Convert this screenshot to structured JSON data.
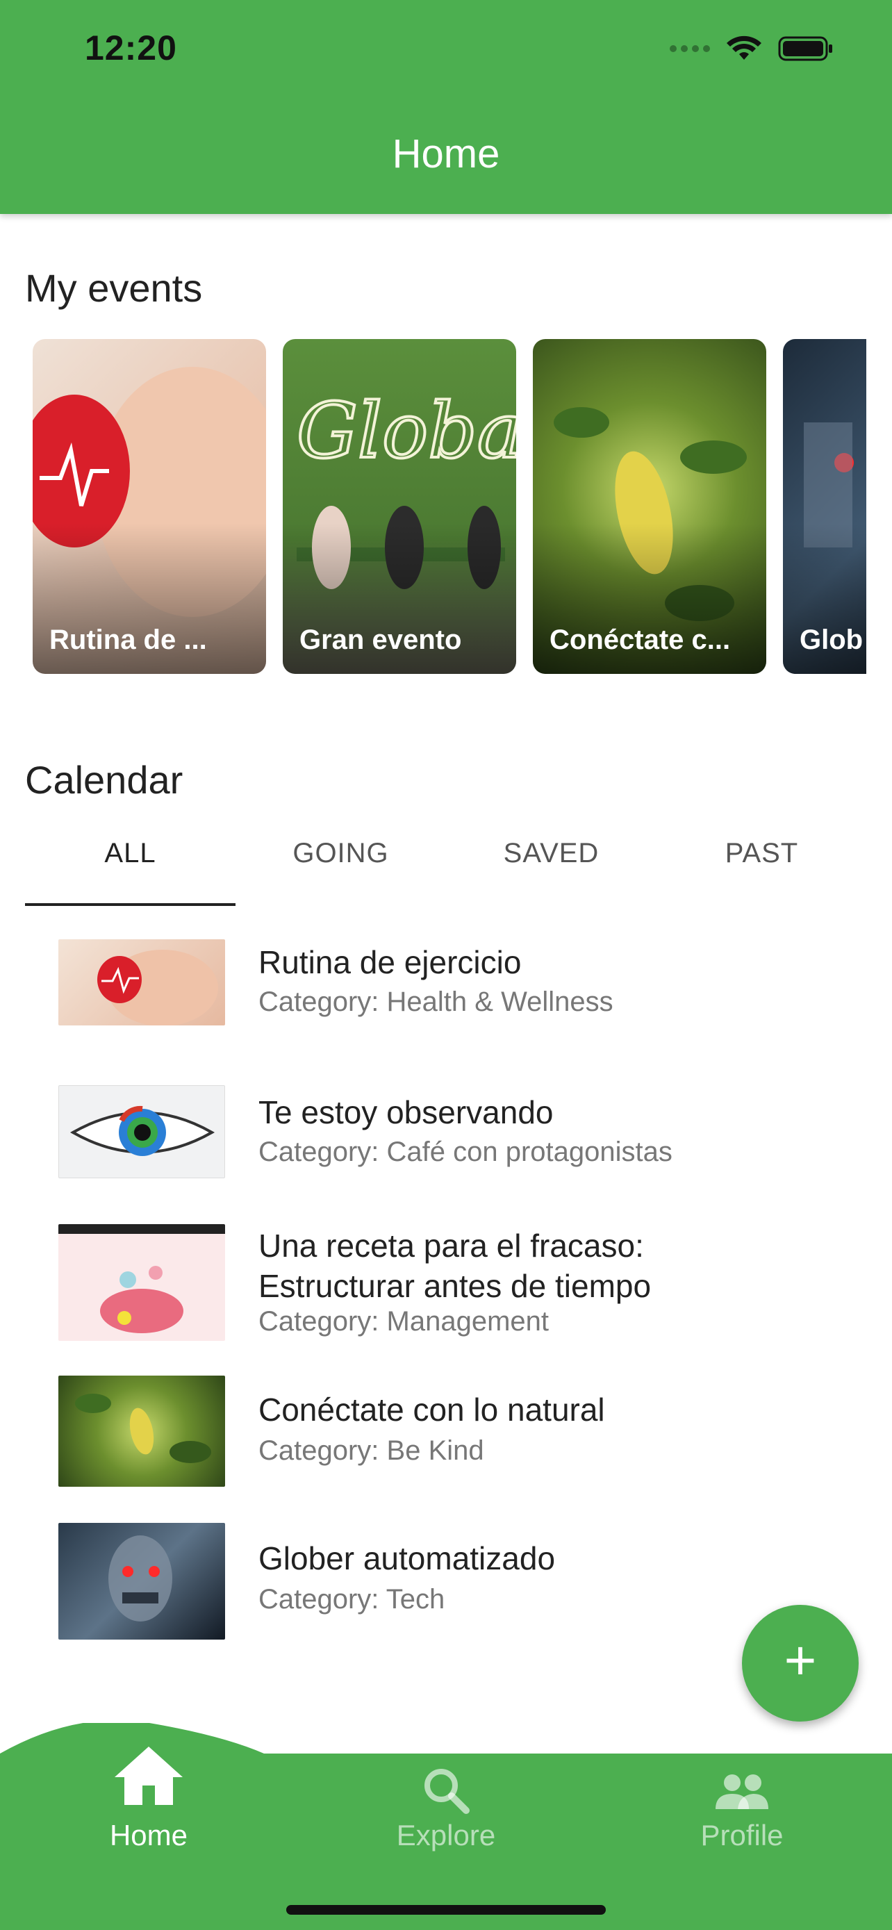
{
  "status_bar": {
    "time": "12:20"
  },
  "app_bar": {
    "title": "Home"
  },
  "my_events": {
    "title": "My events",
    "cards": [
      {
        "label": "Rutina de ..."
      },
      {
        "label": "Gran evento"
      },
      {
        "label": "Conéctate c..."
      },
      {
        "label": "Glob"
      }
    ]
  },
  "calendar": {
    "title": "Calendar",
    "tabs": [
      "ALL",
      "GOING",
      "SAVED",
      "PAST"
    ],
    "active_tab": "ALL",
    "items": [
      {
        "title": "Rutina de ejercicio",
        "category": "Category: Health & Wellness"
      },
      {
        "title": "Te estoy observando",
        "category": "Category: Café con protagonistas"
      },
      {
        "title_line1": "Una receta para el fracaso:",
        "title_line2": "Estructurar antes de tiempo",
        "category": "Category: Management"
      },
      {
        "title": "Conéctate con lo natural",
        "category": "Category: Be Kind"
      },
      {
        "title": "Glober automatizado",
        "category": "Category: Tech"
      }
    ]
  },
  "fab": {
    "label": "+"
  },
  "bottom_nav": {
    "items": [
      {
        "label": "Home",
        "icon": "home-icon",
        "active": true
      },
      {
        "label": "Explore",
        "icon": "search-icon",
        "active": false
      },
      {
        "label": "Profile",
        "icon": "people-icon",
        "active": false
      }
    ]
  },
  "colors": {
    "primary": "#4caf50",
    "text": "#222222",
    "subtext": "#777777"
  }
}
